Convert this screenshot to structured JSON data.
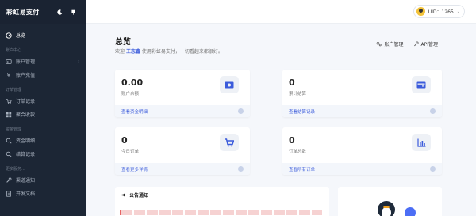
{
  "brand": {
    "name": "彩虹易支付"
  },
  "colors": {
    "sidebar_bg": "#1c2635",
    "accent": "#3b5bdb",
    "page_bg": "#f5f7fb"
  },
  "sidebar": {
    "items": [
      {
        "label": "总览",
        "icon": "dashboard-icon",
        "active": true
      },
      {
        "group": "账户中心"
      },
      {
        "label": "账户管理",
        "icon": "user-card-icon",
        "has_submenu": true
      },
      {
        "label": "账户充值",
        "icon": "yen-icon"
      },
      {
        "group": "订单管理"
      },
      {
        "label": "订单记录",
        "icon": "cart-icon"
      },
      {
        "label": "聚合收款",
        "icon": "grid-icon"
      },
      {
        "group": "资金管理"
      },
      {
        "label": "资金明细",
        "icon": "search-icon"
      },
      {
        "label": "结算记录",
        "icon": "search-icon"
      },
      {
        "group": "更多服务..."
      },
      {
        "label": "渠道通知",
        "icon": "tool-icon"
      },
      {
        "label": "开发文档",
        "icon": "document-icon"
      }
    ]
  },
  "topbar": {
    "user_label": "UID：1265"
  },
  "main": {
    "title": "总览",
    "welcome_prefix": "欢迎",
    "username": "王志鑫",
    "welcome_suffix": "使用彩虹易支付，一切看起来都很好。",
    "links": [
      {
        "label": "账户管理",
        "icon": "gears-icon"
      },
      {
        "label": "API管理",
        "icon": "wrench-icon"
      }
    ],
    "cards": [
      {
        "value": "0.00",
        "label": "账户余额",
        "footer": "查看资金明细",
        "icon": "money-icon"
      },
      {
        "value": "0",
        "label": "累计结算",
        "footer": "查看结算记录",
        "icon": "card-icon"
      },
      {
        "value": "0",
        "label": "今日订单",
        "footer": "查看更多详情",
        "icon": "cart-icon"
      },
      {
        "value": "0",
        "label": "订单总数",
        "footer": "查看所有订单",
        "icon": "bar-chart-icon"
      }
    ],
    "notice": {
      "title": "公告通知",
      "icon": "megaphone-icon"
    }
  }
}
